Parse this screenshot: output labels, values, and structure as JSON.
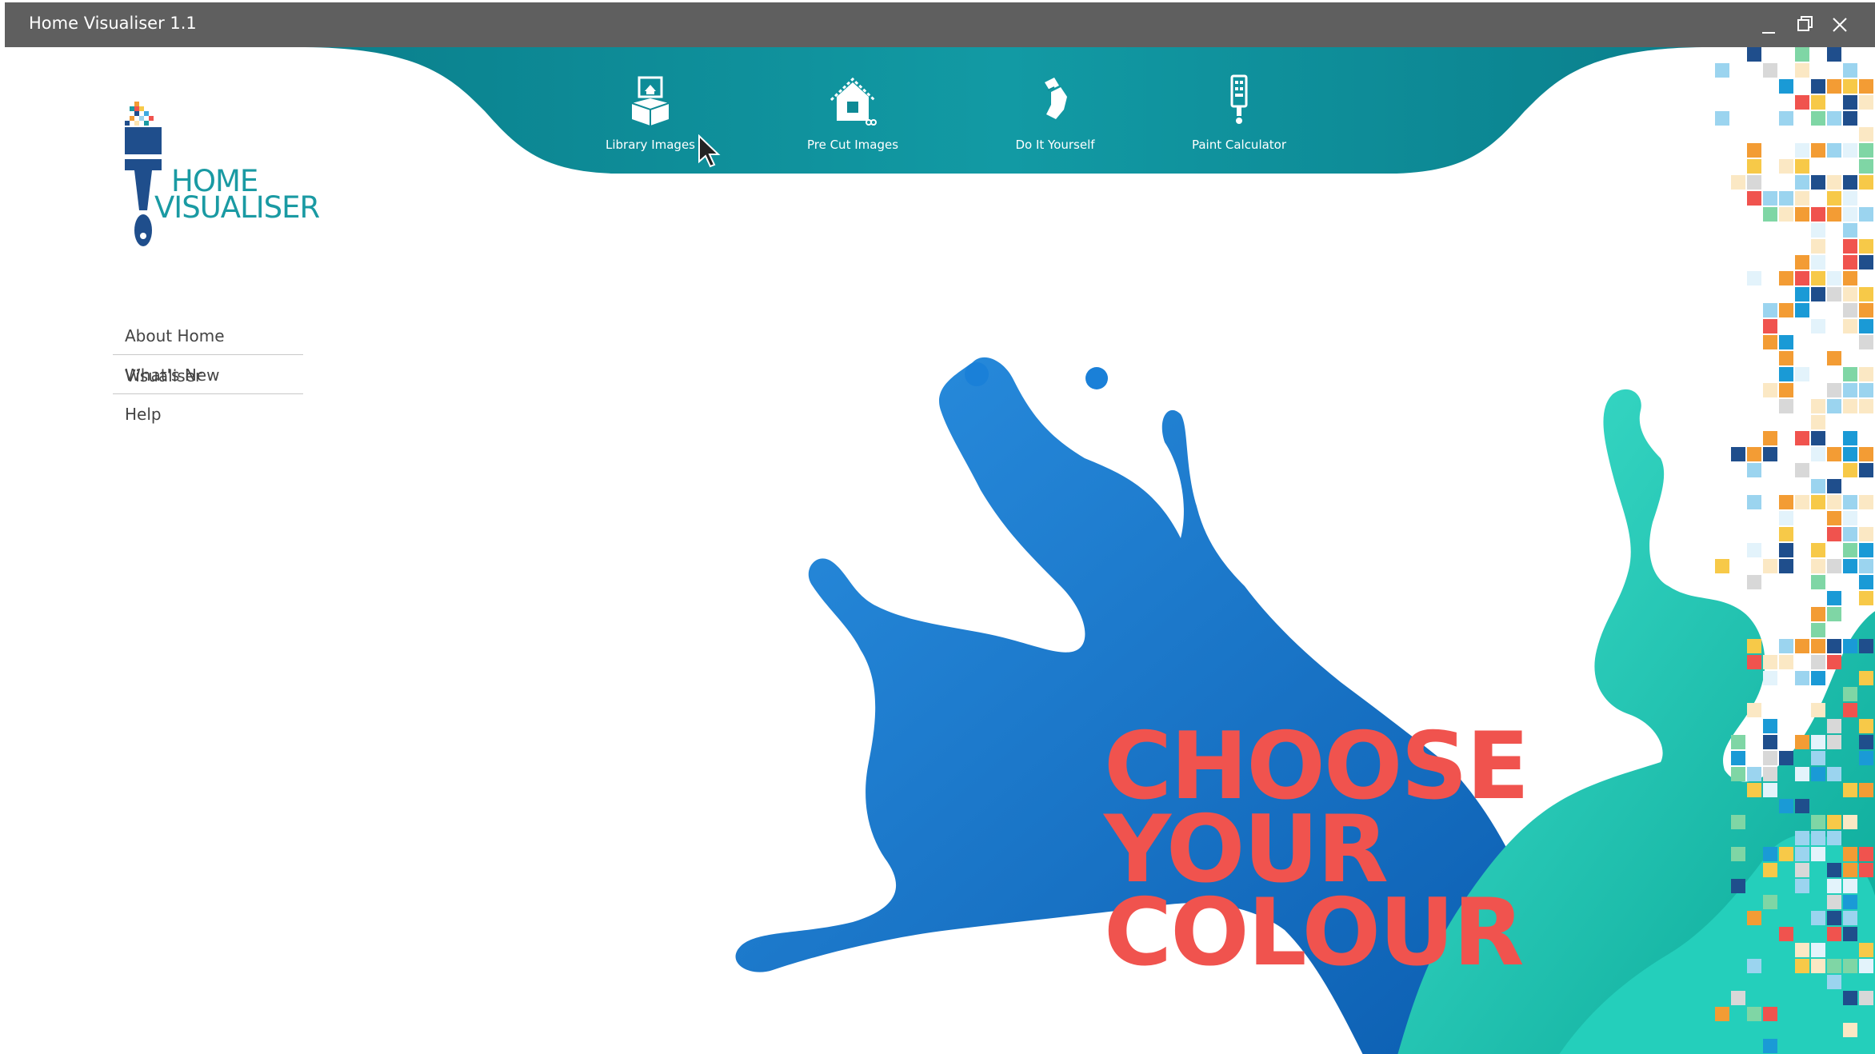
{
  "window": {
    "title": "Home Visualiser 1.1",
    "controls": [
      "minimize",
      "restore",
      "close"
    ]
  },
  "nav": {
    "items": [
      {
        "label": "Library Images",
        "icon": "library-images-icon"
      },
      {
        "label": "Pre Cut Images",
        "icon": "pre-cut-house-icon"
      },
      {
        "label": "Do It Yourself",
        "icon": "paint-tool-icon"
      },
      {
        "label": "Paint Calculator",
        "icon": "calculator-brush-icon"
      }
    ]
  },
  "logo": {
    "line1": "HOME",
    "line2": "VISUALISER"
  },
  "menu": {
    "items": [
      "About Home Visualiser",
      "What's New",
      "Help"
    ]
  },
  "hero": {
    "line1": "CHOOSE",
    "line2": "YOUR",
    "line3": "COLOUR"
  },
  "colors": {
    "titlebar": "#5f5f5f",
    "teal": "#0e8a95",
    "logo_text": "#1a9aa3",
    "headline": "#f0534e",
    "blue_paint": "#1479d1",
    "teal_paint": "#1fc9b5"
  }
}
